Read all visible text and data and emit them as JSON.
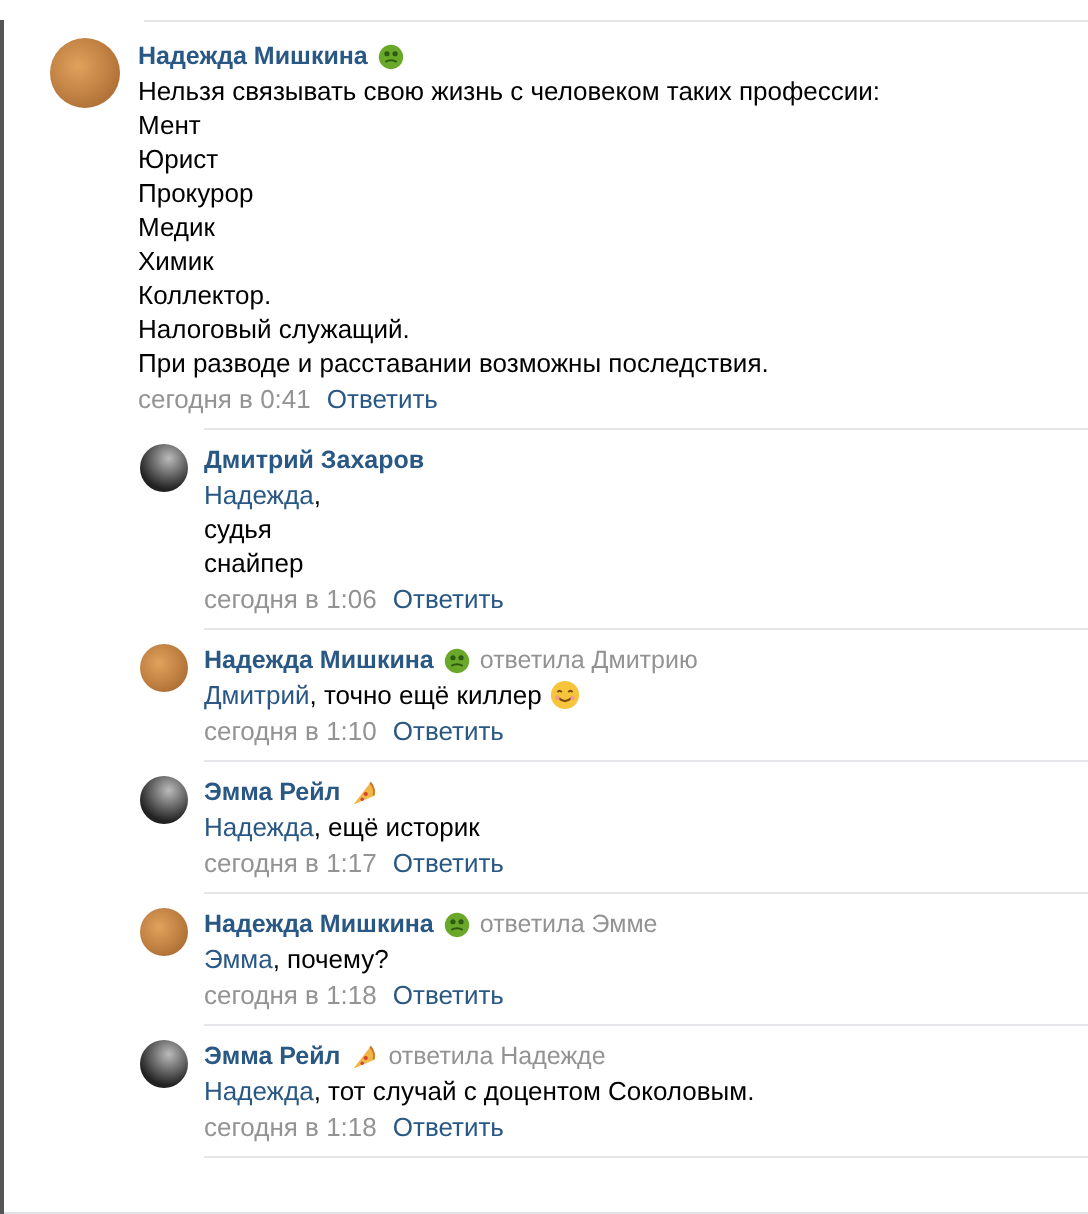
{
  "comment": {
    "author": "Надежда Мишкина",
    "badge": {
      "kind": "frog"
    },
    "avatar": {
      "kind": "warm"
    },
    "lines": [
      {
        "text": "Нельзя связывать свою жизнь с человеком таких профессии:"
      },
      {
        "text": "Мент"
      },
      {
        "text": "Юрист"
      },
      {
        "text": "Прокурор"
      },
      {
        "text": "Медик"
      },
      {
        "text": "Химик"
      },
      {
        "text": "Коллектор."
      },
      {
        "text": "Налоговый служащий."
      },
      {
        "text": "При разводе и расставании возможны последствия."
      }
    ],
    "time": "сегодня в 0:41",
    "reply_link": "Ответить",
    "replies": [
      {
        "author": "Дмитрий Захаров",
        "avatar": {
          "kind": "dark"
        },
        "lines": [
          {
            "mention": "Надежда",
            "text": ","
          },
          {
            "text": "судья"
          },
          {
            "text": "снайпер"
          }
        ],
        "time": "сегодня в 1:06",
        "reply_link": "Ответить"
      },
      {
        "author": "Надежда Мишкина",
        "badge": {
          "kind": "frog"
        },
        "avatar": {
          "kind": "warm"
        },
        "reply_to": "ответила Дмитрию",
        "lines": [
          {
            "mention": "Дмитрий",
            "text": ", точно ещё киллер",
            "emoji": {
              "kind": "smile"
            }
          }
        ],
        "time": "сегодня в 1:10",
        "reply_link": "Ответить"
      },
      {
        "author": "Эмма Рейл",
        "badge": {
          "kind": "pizza"
        },
        "avatar": {
          "kind": "dark"
        },
        "lines": [
          {
            "mention": "Надежда",
            "text": ", ещё историк"
          }
        ],
        "time": "сегодня в 1:17",
        "reply_link": "Ответить"
      },
      {
        "author": "Надежда Мишкина",
        "badge": {
          "kind": "frog"
        },
        "avatar": {
          "kind": "warm"
        },
        "reply_to": "ответила Эмме",
        "lines": [
          {
            "mention": "Эмма",
            "text": ", почему?"
          }
        ],
        "time": "сегодня в 1:18",
        "reply_link": "Ответить"
      },
      {
        "author": "Эмма Рейл",
        "badge": {
          "kind": "pizza"
        },
        "avatar": {
          "kind": "dark"
        },
        "reply_to": "ответила Надежде",
        "lines": [
          {
            "mention": "Надежда",
            "text": ", тот случай с доцентом Соколовым."
          }
        ],
        "time": "сегодня в 1:18",
        "reply_link": "Ответить"
      }
    ]
  }
}
